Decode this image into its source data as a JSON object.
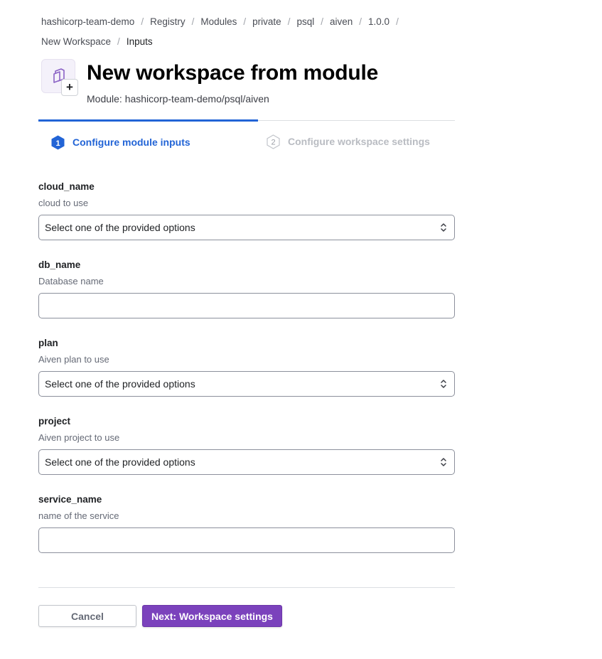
{
  "breadcrumb": {
    "items": [
      "hashicorp-team-demo",
      "Registry",
      "Modules",
      "private",
      "psql",
      "aiven",
      "1.0.0",
      "New Workspace"
    ],
    "current": "Inputs",
    "separator": "/"
  },
  "header": {
    "title": "New workspace from module",
    "subtitle": "Module: hashicorp-team-demo/psql/aiven",
    "plus_glyph": "+"
  },
  "steps": [
    {
      "number": "1",
      "label": "Configure module inputs",
      "active": true
    },
    {
      "number": "2",
      "label": "Configure workspace settings",
      "active": false
    }
  ],
  "fields": [
    {
      "name": "cloud_name",
      "description": "cloud to use",
      "type": "select",
      "value": "Select one of the provided options"
    },
    {
      "name": "db_name",
      "description": "Database name",
      "type": "text",
      "value": ""
    },
    {
      "name": "plan",
      "description": "Aiven plan to use",
      "type": "select",
      "value": "Select one of the provided options"
    },
    {
      "name": "project",
      "description": "Aiven project to use",
      "type": "select",
      "value": "Select one of the provided options"
    },
    {
      "name": "service_name",
      "description": "name of the service",
      "type": "text",
      "value": ""
    }
  ],
  "actions": {
    "cancel_label": "Cancel",
    "next_label": "Next: Workspace settings"
  },
  "colors": {
    "accent_blue": "#2264d6",
    "primary_purple": "#7b42bc",
    "muted": "#b9bcc2"
  },
  "icons": {
    "module": "module-icon",
    "add": "plus-icon",
    "select": "chevron-up-down-icon",
    "step": "step-hexagon-icon"
  }
}
